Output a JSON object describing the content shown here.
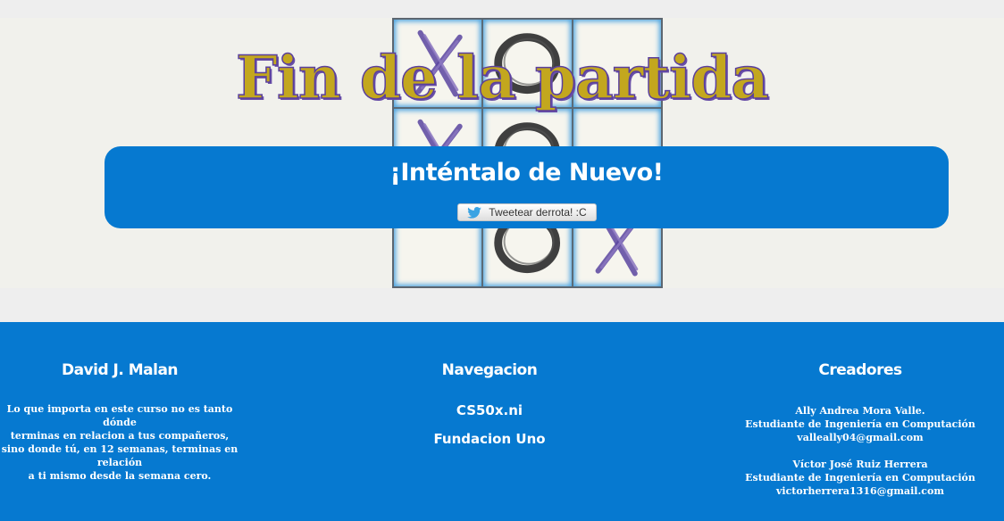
{
  "game": {
    "title": "Fin de la partida",
    "board": [
      "x",
      "o",
      "",
      "x",
      "o",
      "",
      "",
      "o",
      "x"
    ]
  },
  "banner": {
    "message": "¡Inténtalo de Nuevo!",
    "tweet_label": "Tweetear derrota! :C"
  },
  "footer": {
    "left": {
      "heading": "David J. Malan",
      "quote": [
        "Lo que importa en este curso no es tanto dónde",
        "terminas en relacion a tus compañeros,",
        "sino donde tú, en 12 semanas, terminas en relación",
        "a ti mismo desde la semana cero."
      ]
    },
    "middle": {
      "heading": "Navegacion",
      "links": [
        "CS50x.ni",
        "Fundacion Uno"
      ]
    },
    "right": {
      "heading": "Creadores",
      "creator1": {
        "name": "Ally Andrea Mora Valle.",
        "role": "Estudiante de Ingeniería en Computación",
        "email": "valleally04@gmail.com"
      },
      "creator2": {
        "name": "Víctor José Ruiz Herrera",
        "role": "Estudiante de Ingeniería en Computación",
        "email": "victorherrera1316@gmail.com"
      }
    }
  },
  "colors": {
    "accent": "#0679d0",
    "title": "#c3a71e",
    "title_outline": "#5a3f9e"
  }
}
